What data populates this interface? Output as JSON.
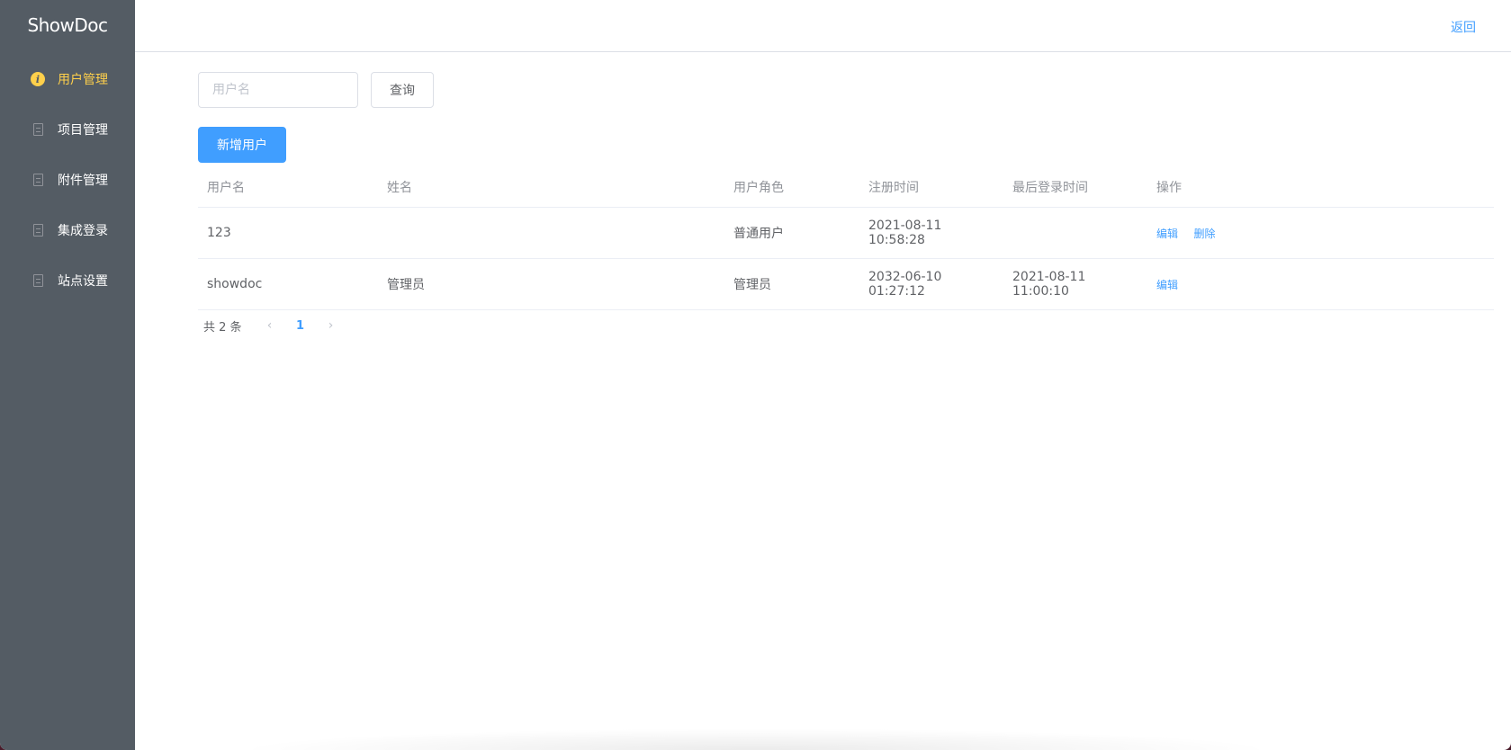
{
  "app": {
    "title": "ShowDoc"
  },
  "sidebar": {
    "items": [
      {
        "label": "用户管理",
        "icon": "info-icon",
        "active": true
      },
      {
        "label": "项目管理",
        "icon": "document-icon",
        "active": false
      },
      {
        "label": "附件管理",
        "icon": "document-icon",
        "active": false
      },
      {
        "label": "集成登录",
        "icon": "document-icon",
        "active": false
      },
      {
        "label": "站点设置",
        "icon": "document-icon",
        "active": false
      }
    ]
  },
  "header": {
    "back_label": "返回"
  },
  "search": {
    "placeholder": "用户名",
    "value": "",
    "button_label": "查询"
  },
  "toolbar": {
    "add_user_label": "新增用户"
  },
  "table": {
    "columns": [
      "用户名",
      "姓名",
      "用户角色",
      "注册时间",
      "最后登录时间",
      "操作"
    ],
    "rows": [
      {
        "username": "123",
        "name": "",
        "role": "普通用户",
        "registered": "2021-08-11 10:58:28",
        "last_login": "",
        "actions": [
          "编辑",
          "删除"
        ]
      },
      {
        "username": "showdoc",
        "name": "管理员",
        "role": "管理员",
        "registered": "2032-06-10 01:27:12",
        "last_login": "2021-08-11 11:00:10",
        "actions": [
          "编辑"
        ]
      }
    ]
  },
  "pagination": {
    "total_text": "共 2 条",
    "current_page": "1",
    "prev_icon": "chevron-left-icon",
    "next_icon": "chevron-right-icon"
  },
  "colors": {
    "sidebar_bg": "#545c64",
    "active": "#ffd04b",
    "primary": "#409eff"
  }
}
